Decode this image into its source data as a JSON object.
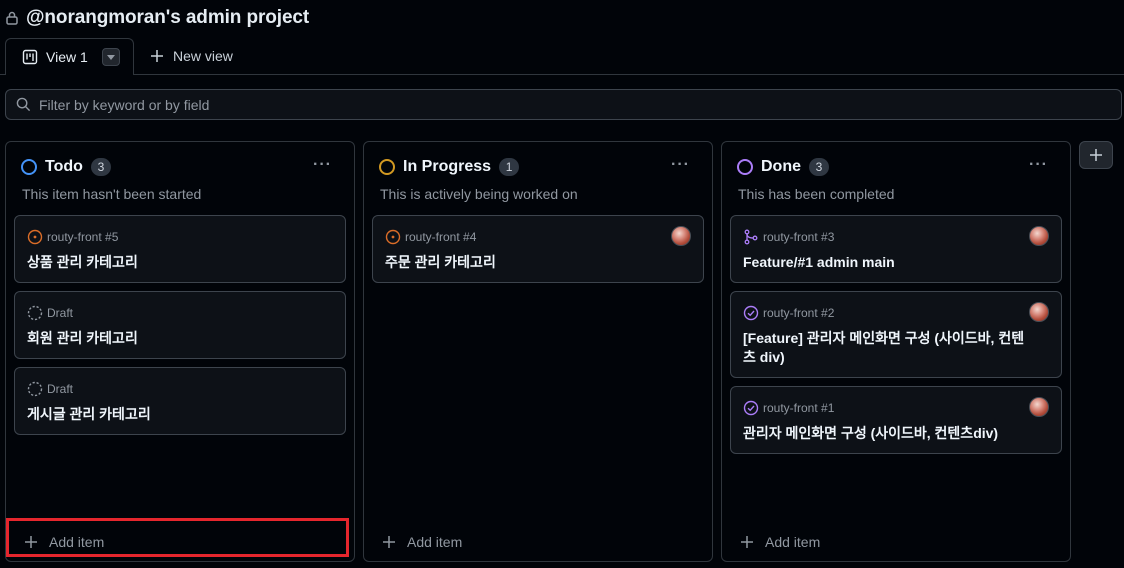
{
  "header": {
    "title": "@norangmoran's admin project"
  },
  "tabs": {
    "active_label": "View 1",
    "new_view_label": "New view"
  },
  "filter": {
    "placeholder": "Filter by keyword or by field"
  },
  "columns": [
    {
      "name": "Todo",
      "count": "3",
      "description": "This item hasn't been started",
      "color": "#4493f8",
      "cards": [
        {
          "meta": "routy-front #5",
          "title": "상품 관리 카테고리",
          "type": "open-issue"
        },
        {
          "meta": "Draft",
          "title": "회원 관리 카테고리",
          "type": "draft"
        },
        {
          "meta": "Draft",
          "title": "게시글 관리 카테고리",
          "type": "draft"
        }
      ],
      "add_label": "Add item"
    },
    {
      "name": "In Progress",
      "count": "1",
      "description": "This is actively being worked on",
      "color": "#d29922",
      "cards": [
        {
          "meta": "routy-front #4",
          "title": "주문 관리 카테고리",
          "type": "open-issue"
        }
      ],
      "add_label": "Add item"
    },
    {
      "name": "Done",
      "count": "3",
      "description": "This has been completed",
      "color": "#ab7df8",
      "cards": [
        {
          "meta": "routy-front #3",
          "title": "Feature/#1 admin main",
          "type": "merged-pr"
        },
        {
          "meta": "routy-front #2",
          "title": "[Feature] 관리자 메인화면 구성 (사이드바, 컨텐츠 div)",
          "type": "closed-issue"
        },
        {
          "meta": "routy-front #1",
          "title": "관리자 메인화면 구성 (사이드바, 컨텐츠div)",
          "type": "closed-issue"
        }
      ],
      "add_label": "Add item"
    }
  ],
  "icons": {
    "lock": "lock-icon",
    "board": "project-board-icon",
    "dropdown": "triangle-down-icon",
    "plus": "plus-icon",
    "search": "search-icon",
    "kebab": "kebab-horizontal-icon",
    "open_issue": "issue-opened-icon",
    "draft": "issue-draft-icon",
    "merged_pr": "git-merge-icon",
    "closed_issue": "issue-closed-icon"
  },
  "colors": {
    "open_issue": "#db6d28",
    "closed_issue": "#ab7df8",
    "draft": "#9198a1",
    "highlight": "#e5262d"
  }
}
